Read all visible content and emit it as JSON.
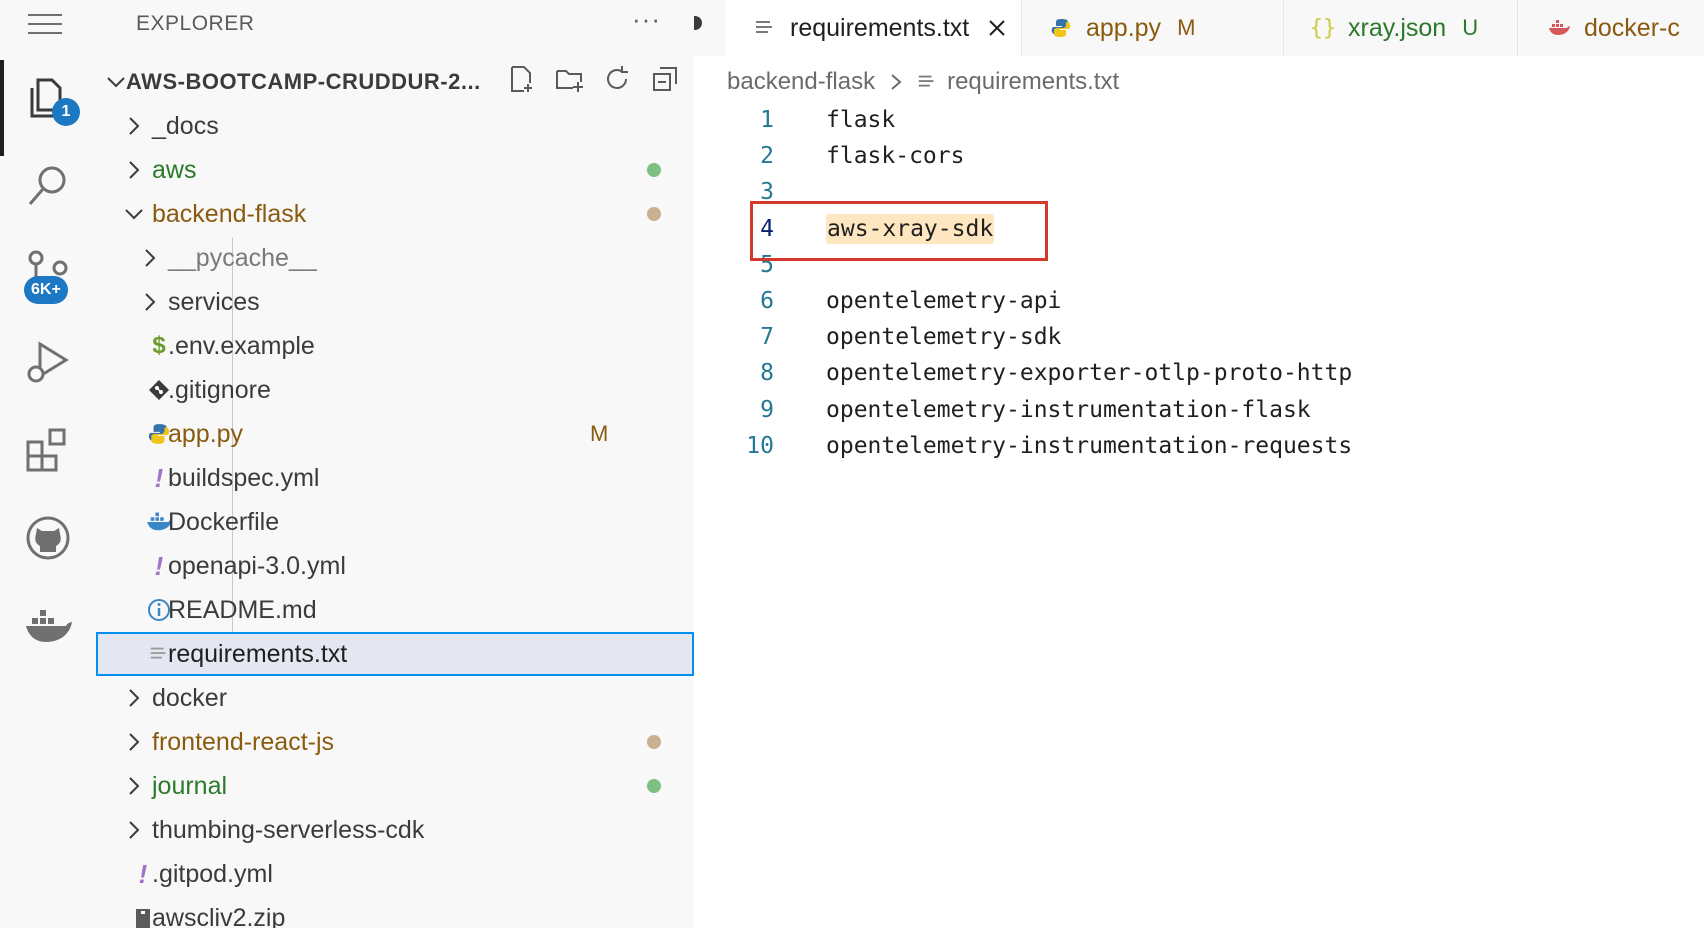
{
  "activity_bar": {
    "explorer_badge": "1",
    "scm_badge": "6K+"
  },
  "sidebar": {
    "title": "EXPLORER",
    "more": "···",
    "root": "AWS-BOOTCAMP-CRUDDUR-2...",
    "items": [
      {
        "label": "_docs",
        "color": "#3b3b3b"
      },
      {
        "label": "aws",
        "color": "#2b7a2b",
        "dot": "#7fbf7f"
      },
      {
        "label": "backend-flask",
        "color": "#8a5a0f",
        "dot": "#c9b08f"
      },
      {
        "label": "__pycache__",
        "color": "#7a7a7a"
      },
      {
        "label": "services",
        "color": "#3b3b3b"
      },
      {
        "label": ".env.example",
        "color": "#3b3b3b",
        "icon": "dollar-icon"
      },
      {
        "label": ".gitignore",
        "color": "#3b3b3b",
        "icon": "git-icon"
      },
      {
        "label": "app.py",
        "color": "#8a5a0f",
        "icon": "python-icon",
        "status": "M"
      },
      {
        "label": "buildspec.yml",
        "color": "#3b3b3b",
        "icon": "exclamation-icon"
      },
      {
        "label": "Dockerfile",
        "color": "#3b3b3b",
        "icon": "docker-icon"
      },
      {
        "label": "openapi-3.0.yml",
        "color": "#3b3b3b",
        "icon": "exclamation-icon"
      },
      {
        "label": "README.md",
        "color": "#3b3b3b",
        "icon": "info-icon"
      },
      {
        "label": "requirements.txt",
        "color": "#1f1f1f",
        "icon": "text-file-icon"
      },
      {
        "label": "docker",
        "color": "#3b3b3b"
      },
      {
        "label": "frontend-react-js",
        "color": "#8a5a0f",
        "dot": "#c9b08f"
      },
      {
        "label": "journal",
        "color": "#2b7a2b",
        "dot": "#7fbf7f"
      },
      {
        "label": "thumbing-serverless-cdk",
        "color": "#3b3b3b"
      },
      {
        "label": ".gitpod.yml",
        "color": "#3b3b3b",
        "icon": "exclamation-icon"
      },
      {
        "label": "awscliv2.zip",
        "color": "#3b3b3b",
        "icon": "zip-icon"
      }
    ]
  },
  "tabs": [
    {
      "label": "requirements.txt",
      "icon": "text-file-icon"
    },
    {
      "label": "app.py",
      "status": "M",
      "icon": "python-icon"
    },
    {
      "label": "xray.json",
      "status": "U",
      "icon": "json-icon"
    },
    {
      "label": "docker-c",
      "icon": "docker-icon"
    }
  ],
  "breadcrumb": {
    "folder": "backend-flask",
    "file": "requirements.txt"
  },
  "code": {
    "lines": [
      {
        "n": "1",
        "text": "flask"
      },
      {
        "n": "2",
        "text": "flask-cors"
      },
      {
        "n": "3",
        "text": ""
      },
      {
        "n": "4",
        "text": "aws-xray-sdk"
      },
      {
        "n": "5",
        "text": ""
      },
      {
        "n": "6",
        "text": "opentelemetry-api"
      },
      {
        "n": "7",
        "text": "opentelemetry-sdk"
      },
      {
        "n": "8",
        "text": "opentelemetry-exporter-otlp-proto-http"
      },
      {
        "n": "9",
        "text": "opentelemetry-instrumentation-flask"
      },
      {
        "n": "10",
        "text": "opentelemetry-instrumentation-requests"
      }
    ]
  },
  "colors": {
    "accent": "#0090f1",
    "highlight_box": "#d4382c",
    "modified": "#8a5a0f",
    "untracked": "#2b7a2b"
  }
}
